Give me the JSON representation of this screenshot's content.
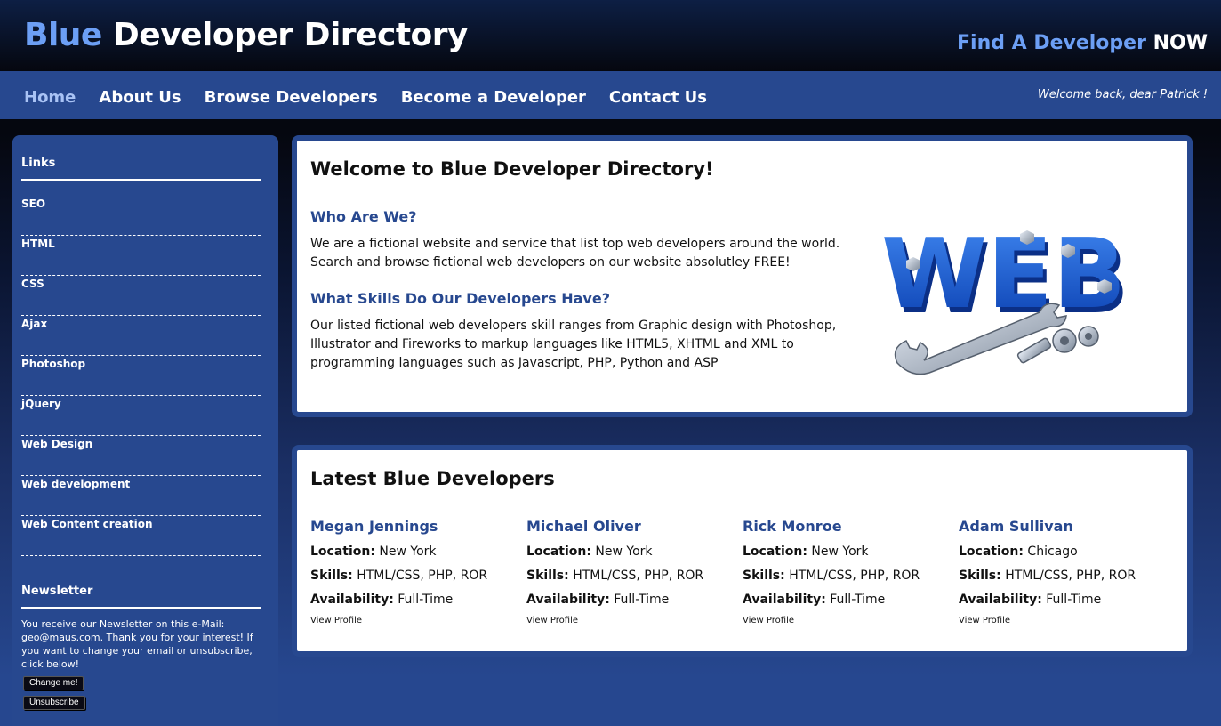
{
  "header": {
    "logo_blue": "Blue",
    "logo_rest": " Developer Directory",
    "find_text": "Find A Developer ",
    "find_now": "NOW"
  },
  "nav": {
    "items": [
      {
        "label": "Home",
        "active": true
      },
      {
        "label": "About Us"
      },
      {
        "label": "Browse Developers"
      },
      {
        "label": "Become a Developer"
      },
      {
        "label": "Contact Us"
      }
    ],
    "welcome": "Welcome back, dear Patrick !"
  },
  "sidebar": {
    "links_heading": "Links",
    "links": [
      "SEO",
      "HTML",
      "CSS",
      "Ajax",
      "Photoshop",
      "jQuery",
      "Web Design",
      "Web development",
      "Web Content creation"
    ],
    "newsletter_heading": "Newsletter",
    "newsletter_text": "You receive our Newsletter on this e-Mail: geo@maus.com. Thank you for your interest! If you want to change your email or unsubscribe, click below!",
    "change_button": "Change me!",
    "unsubscribe_button": "Unsubscribe"
  },
  "welcome_box": {
    "title": "Welcome to Blue Developer Directory!",
    "who_heading": "Who Are We?",
    "who_text": "We are a fictional website and service that list top web developers around the world. Search and browse fictional web developers on our website absolutley FREE!",
    "skills_heading": "What Skills Do Our Developers Have?",
    "skills_text": "Our listed fictional web developers skill ranges from Graphic design with Photoshop, Illustrator and Fireworks to markup languages like HTML5, XHTML and XML to programming languages such as Javascript, PHP, Python and ASP",
    "graphic_text": "WEB"
  },
  "latest_box": {
    "title": "Latest Blue Developers",
    "location_label": "Location:",
    "skills_label": "Skills:",
    "availability_label": "Availability:",
    "developers": [
      {
        "name": "Megan Jennings",
        "location": "New York",
        "skills": "HTML/CSS, PHP, ROR",
        "availability": "Full-Time",
        "link": "View Profile"
      },
      {
        "name": "Michael Oliver",
        "location": "New York",
        "skills": "HTML/CSS, PHP, ROR",
        "availability": "Full-Time",
        "link": "View Profile"
      },
      {
        "name": "Rick Monroe",
        "location": "New York",
        "skills": "HTML/CSS, PHP, ROR",
        "availability": "Full-Time",
        "link": "View Profile"
      },
      {
        "name": "Adam Sullivan",
        "location": "Chicago",
        "skills": "HTML/CSS, PHP, ROR",
        "availability": "Full-Time",
        "link": "View Profile"
      }
    ]
  },
  "colors": {
    "brand_blue": "#27488f",
    "accent_light_blue": "#6c9ff5"
  }
}
